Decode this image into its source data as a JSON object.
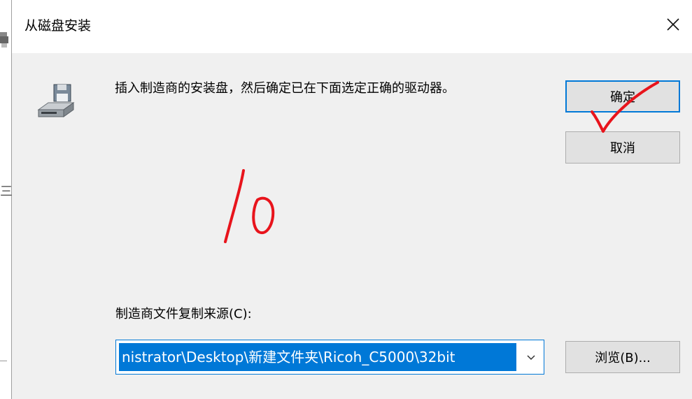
{
  "dialog": {
    "title": "从磁盘安装",
    "message": "插入制造商的安装盘，然后确定已在下面选定正确的驱动器。",
    "ok_label": "确定",
    "cancel_label": "取消",
    "source_label": "制造商文件复制来源(C):",
    "source_value": "nistrator\\Desktop\\新建文件夹\\Ricoh_C5000\\32bit",
    "browse_label": "浏览(B)...",
    "icons": {
      "close": "close-icon",
      "disk": "floppy-drive-icon",
      "dropdown": "chevron-down-icon"
    }
  },
  "background_window": {
    "visible_glyph": "三"
  },
  "colors": {
    "accent": "#0078d7",
    "content_bg": "#f0f0f0",
    "button_bg": "#e1e1e1",
    "annotation_red": "#e8141c"
  }
}
